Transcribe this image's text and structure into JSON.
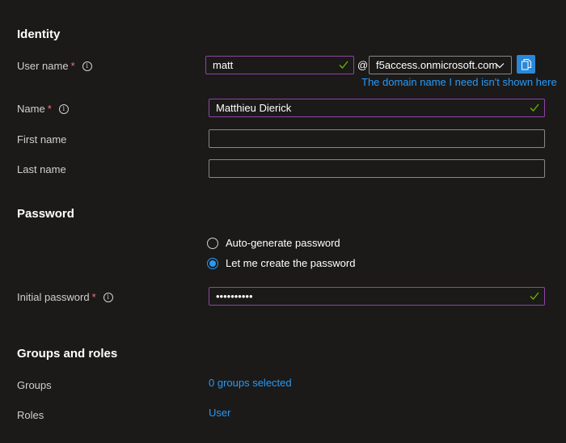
{
  "identity": {
    "title": "Identity",
    "user_name_label": "User name",
    "user_name_value": "matt",
    "at_sign": "@",
    "domain_value": "f5access.onmicrosoft.com",
    "domain_link": "The domain name I need isn't shown here",
    "name_label": "Name",
    "name_value": "Matthieu Dierick",
    "first_name_label": "First name",
    "first_name_value": "",
    "last_name_label": "Last name",
    "last_name_value": ""
  },
  "password": {
    "title": "Password",
    "options": [
      {
        "label": "Auto-generate password",
        "selected": false
      },
      {
        "label": "Let me create the password",
        "selected": true
      }
    ],
    "initial_label": "Initial password",
    "initial_value": "••••••••••"
  },
  "groups_roles": {
    "title": "Groups and roles",
    "groups_label": "Groups",
    "groups_value": "0 groups selected",
    "roles_label": "Roles",
    "roles_value": "User"
  },
  "required_marker": "*",
  "info_glyph": "i",
  "colors": {
    "background": "#1b1a19",
    "accent": "#2899f5",
    "valid_border": "#8f44a5",
    "check": "#6bb700",
    "required": "#f1707b"
  },
  "icons": [
    "info-icon",
    "checkmark-icon",
    "chevron-down-icon",
    "copy-icon"
  ]
}
